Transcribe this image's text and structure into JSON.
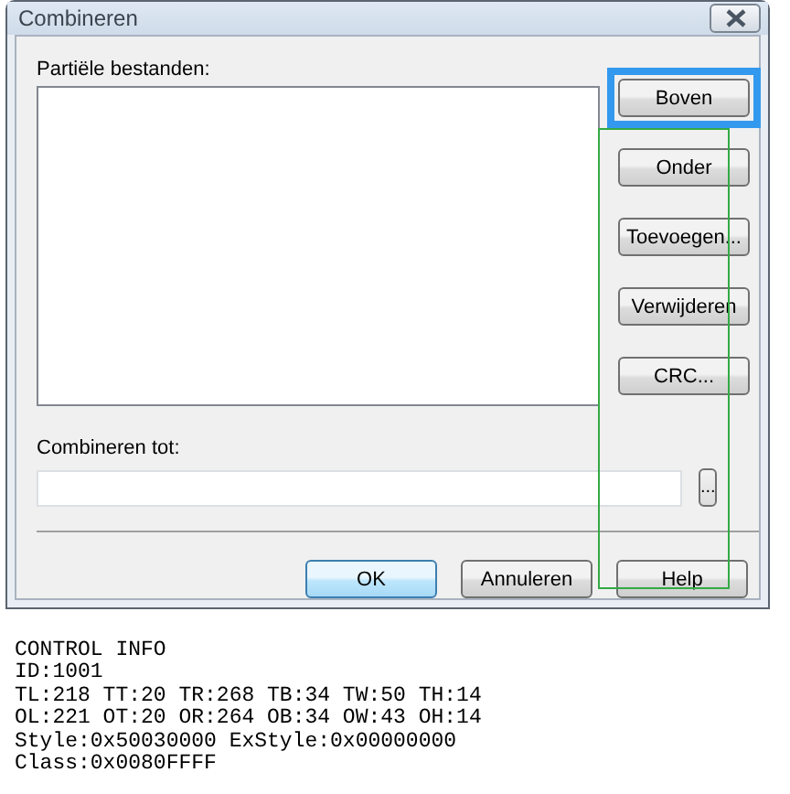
{
  "window": {
    "title": "Combineren"
  },
  "files_label": {
    "text": "Partiële bestanden:"
  },
  "side_buttons": [
    {
      "label": "Boven",
      "selected": true
    },
    {
      "label": "Onder",
      "selected": false
    },
    {
      "label": "Toevoegen...",
      "selected": false
    },
    {
      "label": "Verwijderen",
      "selected": false
    },
    {
      "label": "CRC...",
      "selected": false
    }
  ],
  "target_label": {
    "text": "Combineren tot:"
  },
  "browse_button": {
    "label": "..."
  },
  "footer_buttons": [
    {
      "label": "OK",
      "default": true
    },
    {
      "label": "Annuleren",
      "default": false
    },
    {
      "label": "Help",
      "default": false
    }
  ],
  "control_info": [
    "CONTROL INFO",
    "ID:1001",
    "TL:218 TT:20 TR:268 TB:34 TW:50 TH:14",
    "OL:221 OT:20 OR:264 OB:34 OW:43 OH:14",
    "Style:0x50030000 ExStyle:0x00000000",
    "Class:0x0080FFFF"
  ]
}
